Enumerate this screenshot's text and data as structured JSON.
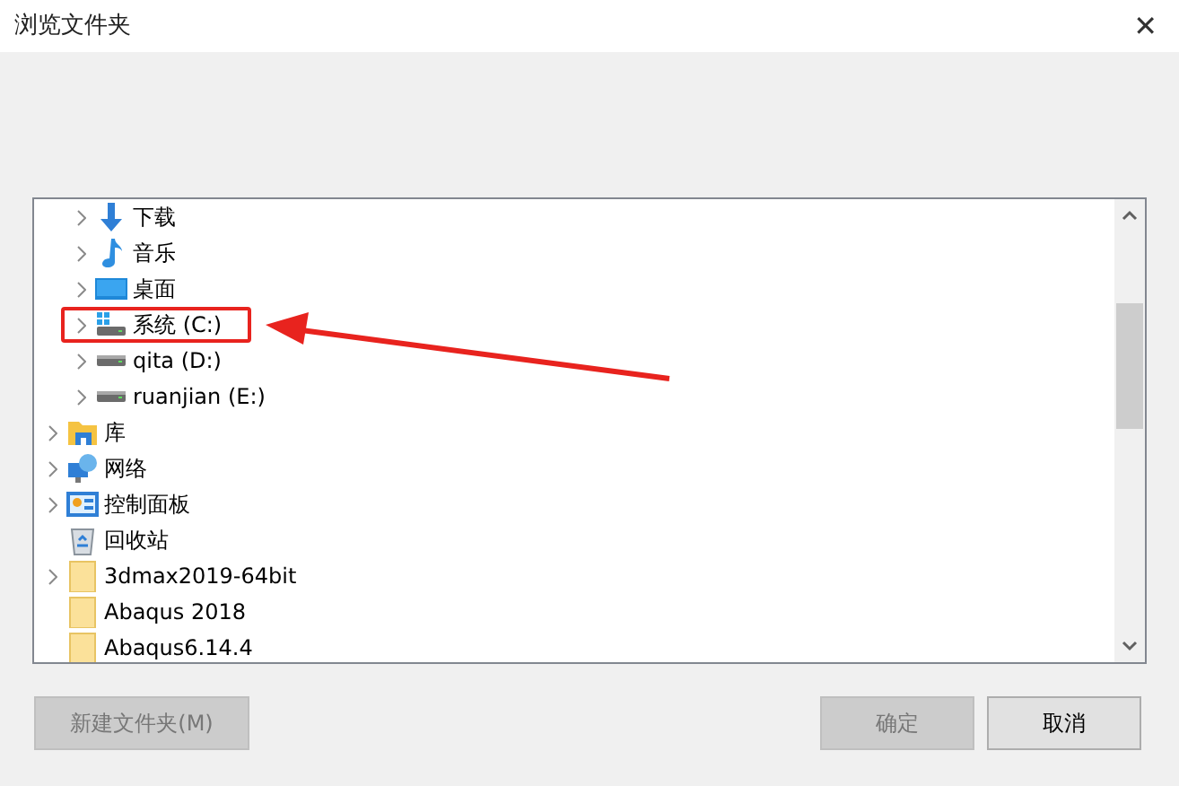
{
  "window": {
    "title": "浏览文件夹",
    "close": "✕"
  },
  "tree": {
    "items": [
      {
        "children": [
          {
            "label": "下载",
            "kind": "download",
            "expandable": true,
            "highlighted": false
          },
          {
            "label": "音乐",
            "kind": "music",
            "expandable": true,
            "highlighted": false
          },
          {
            "label": "桌面",
            "kind": "desktop",
            "expandable": true,
            "highlighted": false
          },
          {
            "label": "系统 (C:)",
            "kind": "system-drive",
            "expandable": true,
            "highlighted": true
          },
          {
            "label": "qita (D:)",
            "kind": "drive",
            "expandable": true,
            "highlighted": false
          },
          {
            "label": "ruanjian (E:)",
            "kind": "drive",
            "expandable": true,
            "highlighted": false
          }
        ]
      },
      {
        "label": "库",
        "kind": "library",
        "expandable": true,
        "highlighted": false
      },
      {
        "label": "网络",
        "kind": "network",
        "expandable": true,
        "highlighted": false
      },
      {
        "label": "控制面板",
        "kind": "control-panel",
        "expandable": true,
        "highlighted": false
      },
      {
        "label": "回收站",
        "kind": "recycle-bin",
        "expandable": false,
        "highlighted": false
      },
      {
        "label": "3dmax2019-64bit",
        "kind": "folder",
        "expandable": true,
        "highlighted": false
      },
      {
        "label": "Abaqus 2018",
        "kind": "folder",
        "expandable": false,
        "highlighted": false
      },
      {
        "label": "Abaqus6.14.4",
        "kind": "folder",
        "expandable": false,
        "highlighted": false
      }
    ]
  },
  "buttons": [
    {
      "label": "新建文件夹(M)",
      "disabled": true
    },
    {
      "label": "确定",
      "disabled": true
    },
    {
      "label": "取消",
      "disabled": false
    }
  ]
}
